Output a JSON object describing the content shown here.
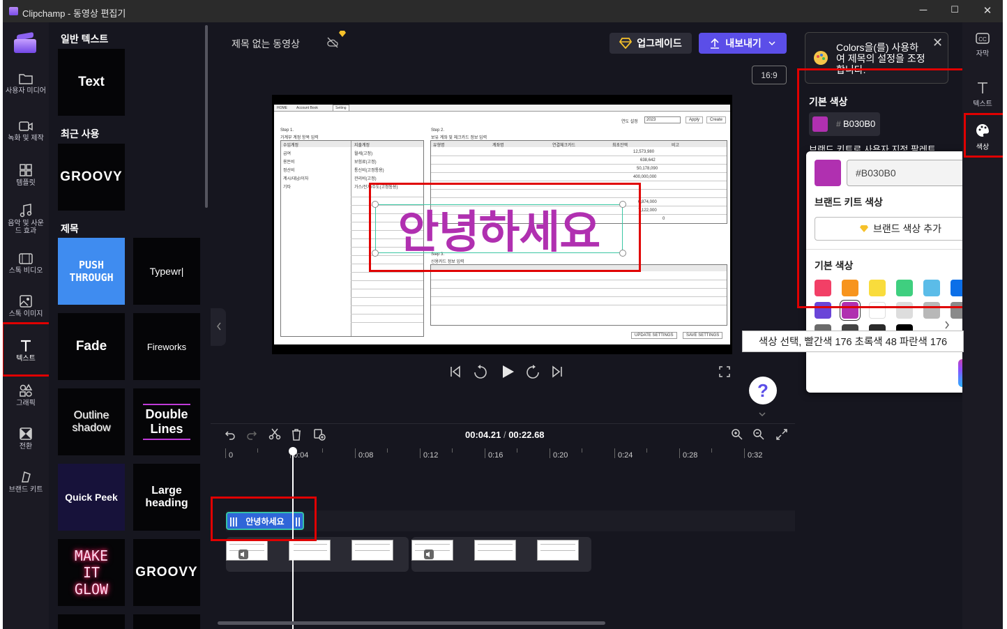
{
  "window": {
    "title": "Clipchamp - 동영상 편집기",
    "minimize": "─",
    "maximize": "☐",
    "close": "✕"
  },
  "left_rail": [
    {
      "label": "사용자 미디어",
      "icon": "folder-icon"
    },
    {
      "label": "녹화 및 제작",
      "icon": "camera-icon"
    },
    {
      "label": "템플릿",
      "icon": "template-icon"
    },
    {
      "label": "음악 및 사운드 효과",
      "icon": "music-icon"
    },
    {
      "label": "스톡 비디오",
      "icon": "film-icon"
    },
    {
      "label": "스톡 이미지",
      "icon": "image-icon"
    },
    {
      "label": "텍스트",
      "icon": "text-icon",
      "selected": true
    },
    {
      "label": "그래픽",
      "icon": "shapes-icon"
    },
    {
      "label": "전환",
      "icon": "transition-icon"
    },
    {
      "label": "브랜드 키트",
      "icon": "brand-icon"
    }
  ],
  "text_panel": {
    "section_plain": "일반 텍스트",
    "section_recent": "최근 사용",
    "section_titles": "제목",
    "tiles": {
      "text": "Text",
      "groovy_recent": "GROOVY",
      "push_through": "PUSH THROUGH",
      "typewriter": "Typewr|",
      "fade": "Fade",
      "fireworks": "Fireworks",
      "outline_shadow": "Outline shadow",
      "double_lines": "Double Lines",
      "quick_peek": "Quick Peek",
      "large_heading": "Large heading",
      "make_it_glow": "MAKE IT GLOW",
      "groovy": "GROOVY"
    }
  },
  "header": {
    "project_name": "제목 없는 동영상",
    "upgrade": "업그레이드",
    "export": "내보내기",
    "aspect": "16:9"
  },
  "preview_sheet": {
    "tabs": [
      "HOME",
      "Account Book",
      "Setting"
    ],
    "year_label": "연도 설정",
    "year_value": "2023",
    "apply": "Apply",
    "create": "Create",
    "step1": "Step 1.",
    "step1_desc": "가계부 계정 항목 입력",
    "step2": "Step 2.",
    "step2_desc": "보유 계좌 및 체크카드 정보 입력",
    "step3": "Step 3.",
    "step3_desc": "신용카드 정보 입력",
    "step1_cols": [
      "수입계정",
      "지출계정"
    ],
    "step1_rows": [
      [
        "급여",
        "월세(고정)"
      ],
      [
        "용돈비",
        "보험료(고정)"
      ],
      [
        "정산비",
        "통신비(고정통용)"
      ],
      [
        "계시/대납/이자",
        "관리비(고정)"
      ],
      [
        "기타",
        "가스/전기/수도(고정통용)"
      ]
    ],
    "step2_cols": [
      "유형명",
      "계좌명",
      "연결체크카드",
      "최초잔액",
      "비고"
    ],
    "step2_amounts": [
      "12,573,980",
      "638,642",
      "50,178,090",
      "400,000,000",
      "6,874,000",
      "7,122,000",
      "0"
    ],
    "update_settings": "UPDATE SETTINGS",
    "save_settings": "SAVE SETTINGS"
  },
  "caption_text": "안녕하세요",
  "timeline": {
    "current": "00:04.21",
    "separator": "/",
    "total": "00:22.68",
    "ruler": [
      "0",
      "0:04",
      "0:08",
      "0:12",
      "0:16",
      "0:20",
      "0:24",
      "0:28",
      "0:32"
    ],
    "text_clip": "안녕하세요"
  },
  "color_panel": {
    "toast": "Colors을(를) 사용하여 제목의 설정을 조정합니다.",
    "base_color_title": "기본 색상",
    "hex_hash": "#",
    "hex_value": "B030B0",
    "hex_field": "#B030B0",
    "brand_palette_hint": "브랜드 키트로 사용자 지정 팔레트",
    "brand_kit_colors": "브랜드 키트 색상",
    "add_brand_color": "브랜드 색상 추가",
    "default_colors": "기본 색상",
    "current_color": "#B030B0",
    "swatches": [
      "#f23f66",
      "#f7941d",
      "#f9dc3c",
      "#3fcf7f",
      "#5bbce8",
      "#0c6fe8",
      "#6a45d8",
      "#b030b0",
      "#ffffff",
      "#dddddd",
      "#b8b8b8",
      "#8a8a8a",
      "#6b6b6b",
      "#444444",
      "#2a2a2a",
      "#000000"
    ]
  },
  "right_rail": [
    {
      "label": "자막",
      "icon": "cc-icon"
    },
    {
      "label": "텍스트",
      "icon": "text-icon"
    },
    {
      "label": "색상",
      "icon": "palette-icon",
      "selected": true
    }
  ],
  "tooltip": "색상 선택, 빨간색 176 초록색 48 파란색 176"
}
